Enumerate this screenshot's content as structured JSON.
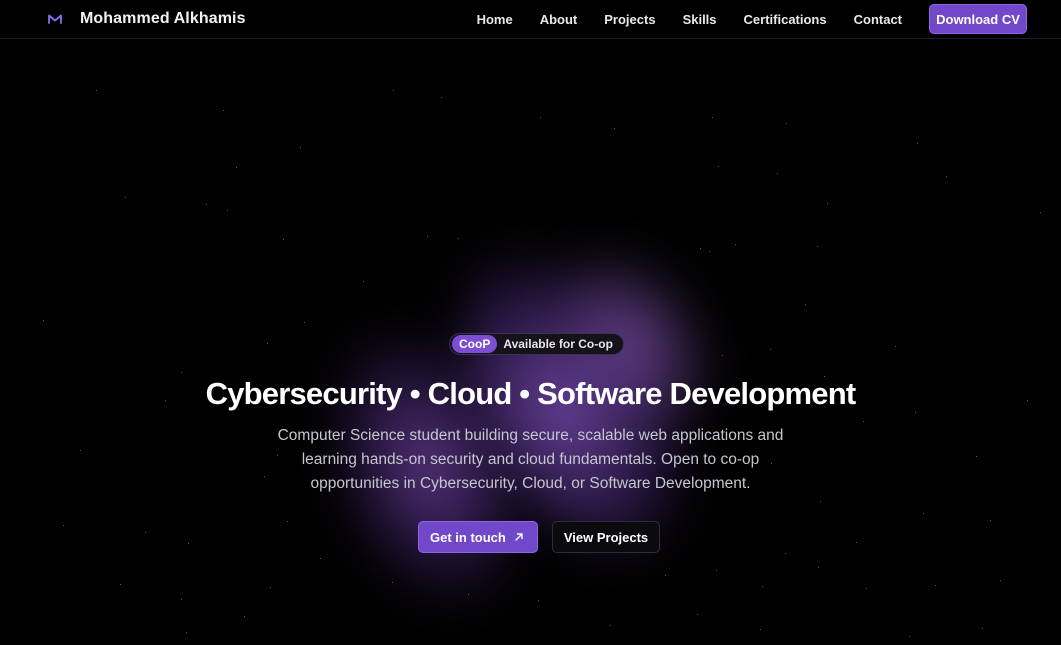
{
  "brand": {
    "name": "Mohammed Alkhamis",
    "logo_icon": "m-logo-icon",
    "accent_color": "#7048c9"
  },
  "nav": {
    "links": [
      "Home",
      "About",
      "Projects",
      "Skills",
      "Certifications",
      "Contact"
    ],
    "download_label": "Download CV"
  },
  "hero": {
    "badge_pill": "CooP",
    "badge_text": "Available for Co-op",
    "title": "Cybersecurity • Cloud • Software Development",
    "subtitle": "Computer Science student building secure, scalable web applications and learning hands-on security and cloud fundamentals. Open to co-op opportunities in Cybersecurity, Cloud, or Software Development.",
    "primary_cta": "Get in touch",
    "primary_cta_icon": "arrow-up-right-icon",
    "secondary_cta": "View Projects"
  },
  "theme": {
    "background": "#000000",
    "glow_color": "#8a55d6"
  }
}
